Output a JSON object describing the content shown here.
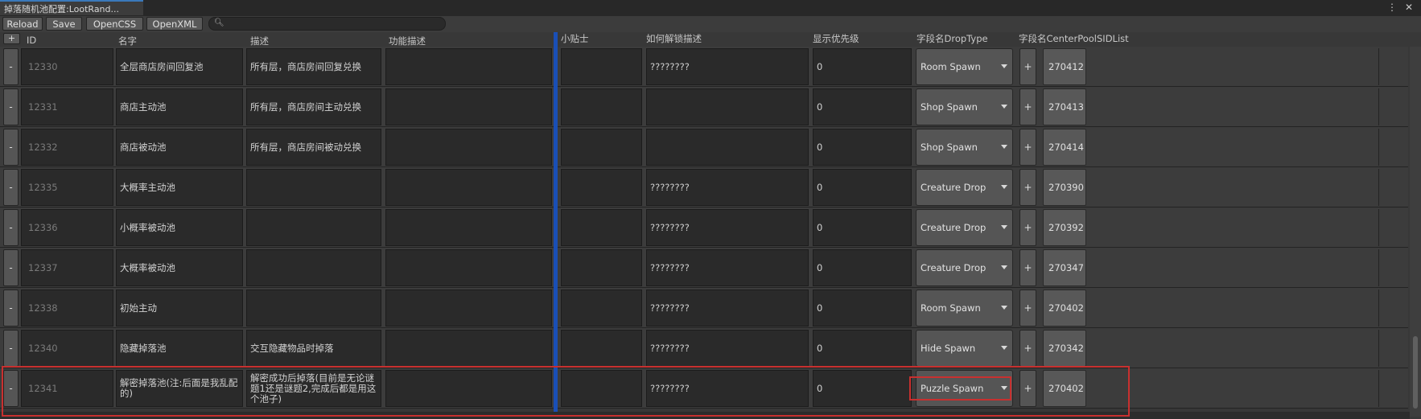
{
  "window": {
    "tab_title": "掉落随机池配置:LootRand...",
    "menu_glyph": "⋮",
    "close_glyph": "✕"
  },
  "toolbar": {
    "reload": "Reload",
    "save": "Save",
    "open_css": "OpenCSS",
    "open_xml": "OpenXML",
    "search_placeholder": "",
    "search_icon": "search-icon"
  },
  "columns": {
    "add": "+",
    "id": "ID",
    "name": "名字",
    "desc": "描述",
    "func_desc": "功能描述",
    "tip": "小贴士",
    "unlock": "如何解锁描述",
    "priority": "显示优先级",
    "drop_type": "字段名DropType",
    "pool_list": "字段名CenterPoolSIDList"
  },
  "rows": [
    {
      "id": "12330",
      "name": "全层商店房间回复池",
      "desc": "所有层，商店房间回复兑换",
      "func": "",
      "tip": "",
      "unlock": "????????",
      "priority": "0",
      "drop": "Room Spawn",
      "sid": "270412"
    },
    {
      "id": "12331",
      "name": "商店主动池",
      "desc": "所有层，商店房间主动兑换",
      "func": "",
      "tip": "",
      "unlock": "",
      "priority": "0",
      "drop": "Shop Spawn",
      "sid": "270413"
    },
    {
      "id": "12332",
      "name": "商店被动池",
      "desc": "所有层，商店房间被动兑换",
      "func": "",
      "tip": "",
      "unlock": "",
      "priority": "0",
      "drop": "Shop Spawn",
      "sid": "270414"
    },
    {
      "id": "12335",
      "name": "大概率主动池",
      "desc": "",
      "func": "",
      "tip": "",
      "unlock": "????????",
      "priority": "0",
      "drop": "Creature Drop",
      "sid": "270390"
    },
    {
      "id": "12336",
      "name": "小概率被动池",
      "desc": "",
      "func": "",
      "tip": "",
      "unlock": "????????",
      "priority": "0",
      "drop": "Creature Drop",
      "sid": "270392"
    },
    {
      "id": "12337",
      "name": "大概率被动池",
      "desc": "",
      "func": "",
      "tip": "",
      "unlock": "????????",
      "priority": "0",
      "drop": "Creature Drop",
      "sid": "270347"
    },
    {
      "id": "12338",
      "name": "初始主动",
      "desc": "",
      "func": "",
      "tip": "",
      "unlock": "????????",
      "priority": "0",
      "drop": "Room Spawn",
      "sid": "270402"
    },
    {
      "id": "12340",
      "name": "隐藏掉落池",
      "desc": "交互隐藏物品时掉落",
      "func": "",
      "tip": "",
      "unlock": "????????",
      "priority": "0",
      "drop": "Hide Spawn",
      "sid": "270342"
    },
    {
      "id": "12341",
      "name": "解密掉落池(注:后面是我乱配的)",
      "desc": "解密成功后掉落(目前是无论谜题1还是谜题2,完成后都是用这个池子)",
      "func": "",
      "tip": "",
      "unlock": "????????",
      "priority": "0",
      "drop": "Puzzle Spawn",
      "sid": "270402"
    }
  ],
  "row_button": {
    "minus": "-",
    "plus": "+"
  },
  "accent": {
    "divider": "#1a4fb6",
    "highlight": "#c8302f"
  }
}
